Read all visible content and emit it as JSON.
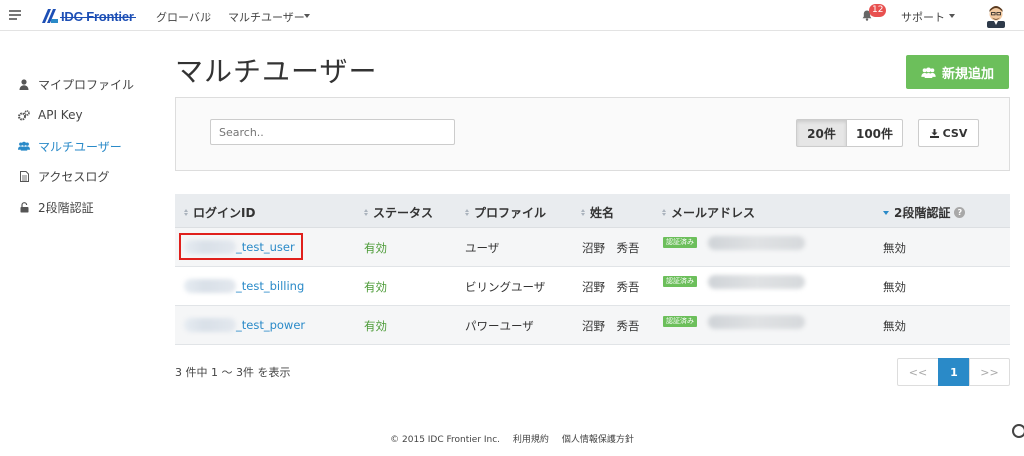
{
  "header": {
    "logo_text": "IDC Frontier",
    "breadcrumb": [
      "グローバル",
      "マルチユーザー"
    ],
    "breadcrumb_sep": "›",
    "notifications_count": "12",
    "support_label": "サポート"
  },
  "sidebar": {
    "items": [
      {
        "label": "マイプロファイル",
        "icon": "user-icon",
        "active": false
      },
      {
        "label": "API Key",
        "icon": "gears-icon",
        "active": false
      },
      {
        "label": "マルチユーザー",
        "icon": "users-icon",
        "active": true
      },
      {
        "label": "アクセスログ",
        "icon": "document-icon",
        "active": false
      },
      {
        "label": "2段階認証",
        "icon": "unlock-icon",
        "active": false
      }
    ]
  },
  "main": {
    "title": "マルチユーザー",
    "add_button": "新規追加",
    "search_placeholder": "Search..",
    "page_sizes": [
      "20件",
      "100件"
    ],
    "page_size_selected": "20件",
    "csv_button": "CSV",
    "columns": [
      "ログインID",
      "ステータス",
      "プロファイル",
      "姓名",
      "メールアドレス",
      "2段階認証"
    ],
    "sorted_column": "2段階認証",
    "rows": [
      {
        "login_id": "_test_user",
        "status": "有効",
        "profile": "ユーザ",
        "name": "沼野　秀吾",
        "email_badge": "認証済み",
        "two_factor": "無効"
      },
      {
        "login_id": "_test_billing",
        "status": "有効",
        "profile": "ビリングユーザ",
        "name": "沼野　秀吾",
        "email_badge": "認証済み",
        "two_factor": "無効"
      },
      {
        "login_id": "_test_power",
        "status": "有効",
        "profile": "パワーユーザ",
        "name": "沼野　秀吾",
        "email_badge": "認証済み",
        "two_factor": "無効"
      }
    ],
    "count_text": "3 件中 1 ～ 3件 を表示",
    "pagination": {
      "prev": "<<",
      "current": "1",
      "next": ">>"
    }
  },
  "footer": {
    "copyright": "© 2015 IDC Frontier Inc.",
    "terms": "利用規約",
    "privacy": "個人情報保護方針"
  },
  "colors": {
    "accent": "#2a8ac8",
    "success": "#6cbf5b",
    "badge": "#e8504f",
    "highlight": "#e0201c"
  }
}
